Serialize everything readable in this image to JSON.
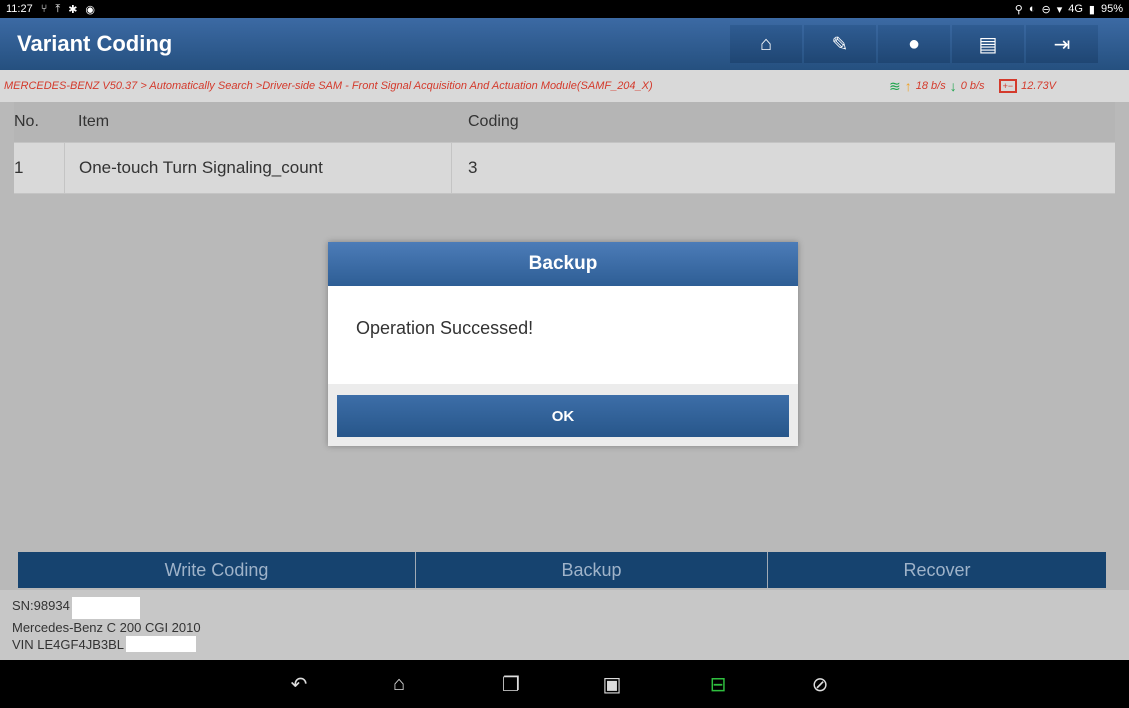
{
  "status_bar": {
    "time": "11:27",
    "left_icons": [
      "usb-icon",
      "upload-icon",
      "bluetooth-icon",
      "message-icon"
    ],
    "right_icons": [
      "location-icon",
      "vpn-icon",
      "dnd-icon",
      "signal-icon"
    ],
    "network": "4G",
    "battery": "95%"
  },
  "header": {
    "title": "Variant Coding",
    "buttons": [
      "home-icon",
      "edit-icon",
      "message-icon",
      "print-icon",
      "exit-icon"
    ]
  },
  "breadcrumb": {
    "text": "MERCEDES-BENZ V50.37 > Automatically Search >Driver-side SAM - Front Signal Acquisition And Actuation Module(SAMF_204_X)",
    "upload_rate": "18 b/s",
    "download_rate": "0 b/s",
    "voltage": "12.73V"
  },
  "table": {
    "headers": {
      "no": "No.",
      "item": "Item",
      "coding": "Coding"
    },
    "rows": [
      {
        "no": "1",
        "item": "One-touch Turn Signaling_count",
        "coding": "3"
      }
    ]
  },
  "dialog": {
    "title": "Backup",
    "message": "Operation Successed!",
    "ok_label": "OK"
  },
  "actions": {
    "write": "Write Coding",
    "backup": "Backup",
    "recover": "Recover"
  },
  "vehicle": {
    "sn": "SN:98934",
    "model": "Mercedes-Benz C 200 CGI 2010",
    "vin": "VIN LE4GF4JB3BL"
  },
  "colors": {
    "header_blue": "#25507f",
    "breadcrumb_red": "#d43a2c",
    "action_bar": "#16436f"
  }
}
